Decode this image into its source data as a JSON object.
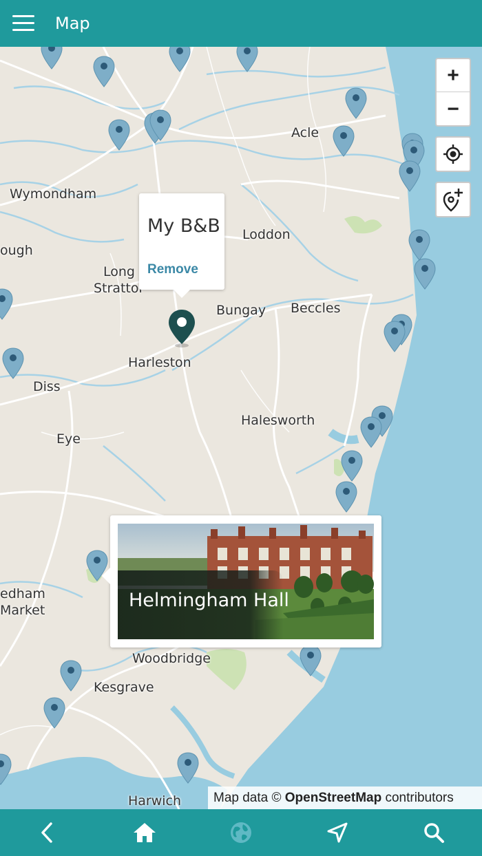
{
  "header": {
    "title": "Map",
    "menu_icon": "hamburger-menu-icon"
  },
  "map": {
    "towns": [
      {
        "name": "Acle"
      },
      {
        "name": "Wymondham"
      },
      {
        "name": "Loddon"
      },
      {
        "name": "ough"
      },
      {
        "name": "Long"
      },
      {
        "name": "Strattor"
      },
      {
        "name": "Bungay"
      },
      {
        "name": "Beccles"
      },
      {
        "name": "Harleston"
      },
      {
        "name": "Diss"
      },
      {
        "name": "Halesworth"
      },
      {
        "name": "Eye"
      },
      {
        "name": "edham"
      },
      {
        "name": "Market"
      },
      {
        "name": "Woodbridge"
      },
      {
        "name": "Kesgrave"
      },
      {
        "name": "Harwich"
      }
    ],
    "colors": {
      "land": "#ebe7df",
      "sea": "#98cce0",
      "river": "#a7d2e6",
      "road": "#ffffff",
      "pin": "#7eaec8",
      "pin_dot": "#2d5a78",
      "selected_pin": "#1d4f4f",
      "accent": "#1f9a9c"
    }
  },
  "controls": {
    "zoom_in": "+",
    "zoom_out": "−",
    "locate_icon": "crosshair-icon",
    "add_place_icon": "add-location-icon"
  },
  "popup": {
    "title": "My B&B",
    "remove_label": "Remove"
  },
  "card": {
    "title": "Helmingham Hall"
  },
  "attribution": {
    "prefix": "Map data © ",
    "brand": "OpenStreetMap",
    "suffix": " contributors"
  },
  "bottom_nav": {
    "back_icon": "back-arrow-icon",
    "home_icon": "home-icon",
    "globe_icon": "globe-icon",
    "navigate_icon": "navigation-arrow-icon",
    "search_icon": "search-icon"
  }
}
